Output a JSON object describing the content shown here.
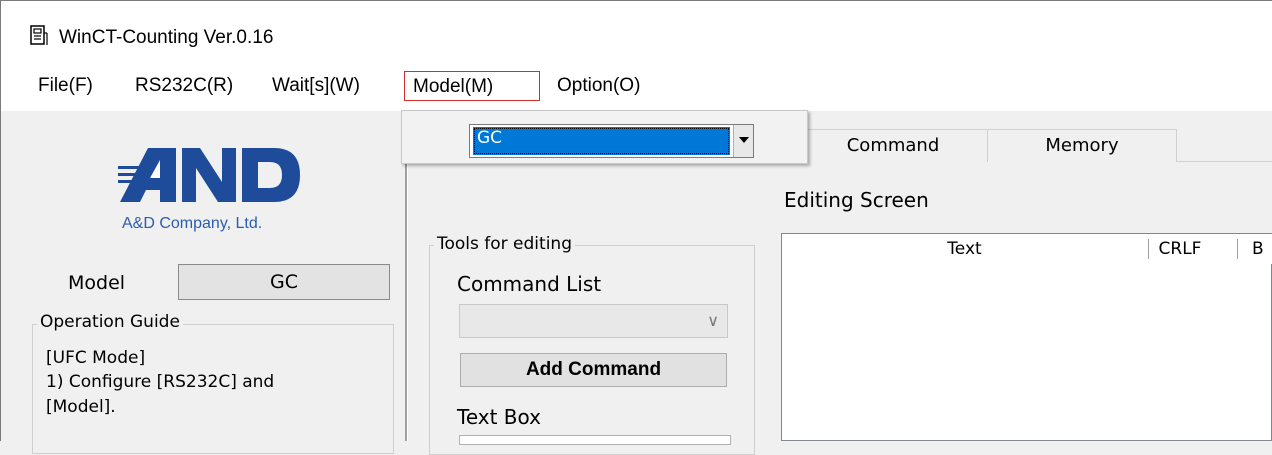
{
  "window": {
    "title": "WinCT-Counting Ver.0.16",
    "icon": "app-icon"
  },
  "menubar": {
    "items": [
      "File(F)",
      "RS232C(R)",
      "Wait[s](W)",
      "Model(M)",
      "Option(O)"
    ],
    "active": "Model(M)"
  },
  "model_menu": {
    "selected": "GC"
  },
  "left_panel": {
    "company": "A&D Company, Ltd.",
    "model_label": "Model",
    "model_value": "GC",
    "guide_title": "Operation Guide",
    "guide_lines": [
      "[UFC Mode]",
      "1) Configure [RS232C] and",
      "[Model]."
    ]
  },
  "tabs": [
    "Command",
    "Memory"
  ],
  "editing": {
    "title": "Editing Screen",
    "columns": [
      "Text",
      "CRLF",
      "B"
    ]
  },
  "tools": {
    "title": "Tools for editing",
    "command_list_label": "Command List",
    "command_list_value": "",
    "add_button": "Add Command",
    "text_box_label": "Text Box"
  },
  "colors": {
    "accent": "#0078d7",
    "logo": "#1e4c9a",
    "highlight_border": "#d32f2f"
  }
}
